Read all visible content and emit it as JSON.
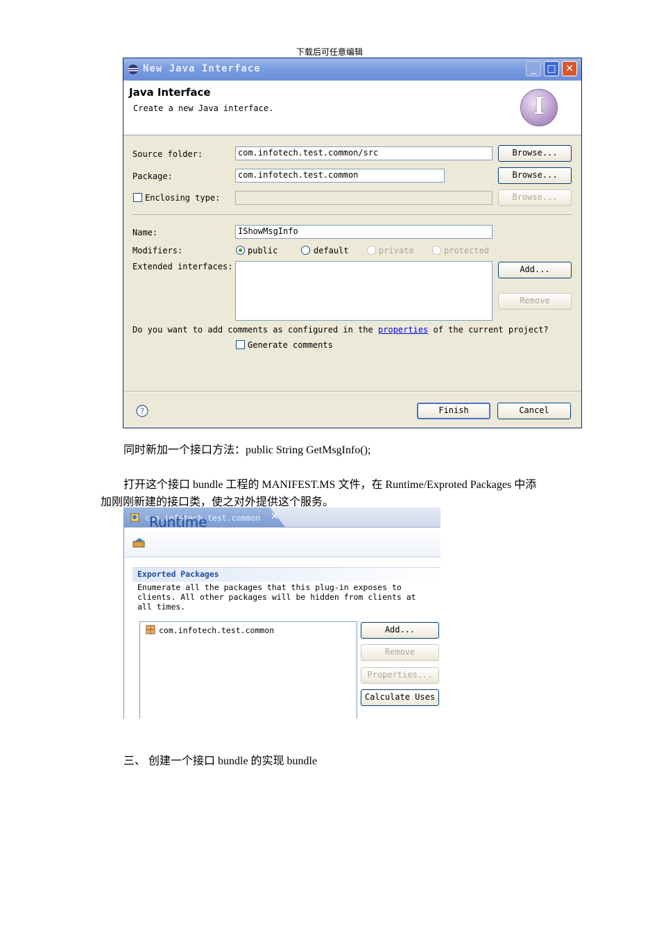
{
  "header_note": "下载后可任意编辑",
  "dialog": {
    "window_title": "New Java Interface",
    "banner_title": "Java Interface",
    "banner_desc": "Create a new Java interface.",
    "banner_icon": "interface-wizard-icon",
    "source_folder_label": "Source folder:",
    "source_folder_value": "com.infotech.test.common/src",
    "package_label": "Package:",
    "package_value": "com.infotech.test.common",
    "enclosing_type_label": "Enclosing type:",
    "enclosing_type_value": "",
    "browse_label": "Browse...",
    "name_label": "Name:",
    "name_value": "IShowMsgInfo",
    "modifiers_label": "Modifiers:",
    "modifiers": [
      "public",
      "default",
      "private",
      "protected"
    ],
    "modifier_selected": "public",
    "extended_label": "Extended interfaces:",
    "add_label": "Add...",
    "remove_label": "Remove",
    "comments_prefix": "Do you want to add comments as configured in the",
    "comments_link": "properties",
    "comments_suffix": "of the current project?",
    "generate_label": "Generate comments",
    "finish_label": "Finish",
    "cancel_label": "Cancel",
    "help_icon": "help-icon"
  },
  "paragraph1": "同时新加一个接口方法：public String GetMsgInfo();",
  "paragraph2_line1": "打开这个接口 bundle 工程的 MANIFEST.MS 文件，在 Runtime/Exproted Packages 中添",
  "paragraph2_line2": "加刚刚新建的接口类，使之对外提供这个服务。",
  "manifest": {
    "tab_label": "com.infotech.test.common",
    "page_title": "Runtime",
    "section_title": "Exported Packages",
    "section_desc_1": "Enumerate all the packages that this plug-in exposes to",
    "section_desc_2": "clients.  All other packages will be hidden from clients at",
    "section_desc_3": "all times.",
    "packages": [
      "com.infotech.test.common"
    ],
    "add_label": "Add...",
    "remove_label": "Remove",
    "properties_label": "Properties...",
    "calculate_label": "Calculate Uses"
  },
  "heading3": "三、 创建一个接口 bundle 的实现 bundle",
  "colors": {
    "title_bar": "#7a9cdf",
    "dialog_bg": "#ece9d8",
    "runtime_title": "#1e4f9c",
    "link": "#0000ee"
  }
}
